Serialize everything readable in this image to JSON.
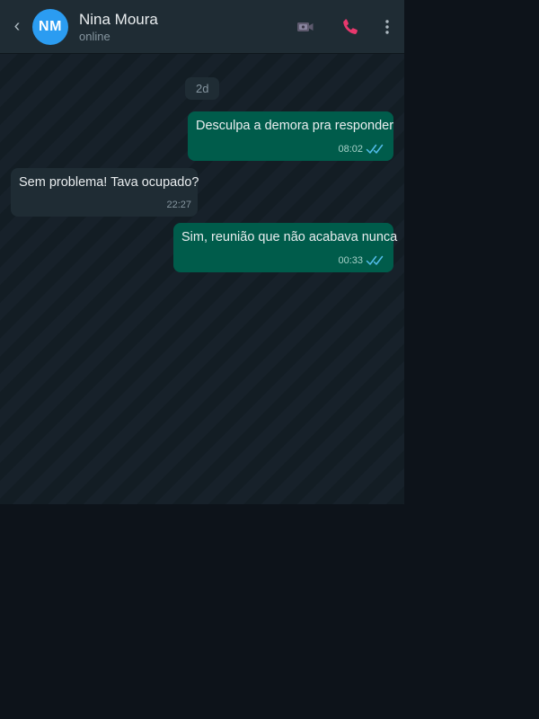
{
  "header": {
    "back_label": "‹",
    "avatar_initials": "NM",
    "contact_name": "Nina Moura",
    "contact_status": "online",
    "icons": [
      "video-call-icon",
      "voice-call-icon",
      "more-options-icon"
    ]
  },
  "chat": {
    "date_divider": "2d",
    "messages": [
      {
        "direction": "outgoing",
        "text": "Desculpa a demora pra responder",
        "time": "08:02",
        "status": "read"
      },
      {
        "direction": "incoming",
        "text": "Sem problema! Tava ocupado?",
        "time": "22:27"
      },
      {
        "direction": "outgoing",
        "text": "Sim, reunião que não acabava nunca",
        "time": "00:33",
        "status": "read"
      }
    ]
  },
  "colors": {
    "header_bg": "#1f2c34",
    "avatar_bg": "#2b9cf1",
    "outgoing_bubble": "#005c4b",
    "incoming_bubble": "#1f2c34",
    "read_ticks": "#53bdeb",
    "call_icon": "#e8386d",
    "page_bg": "#0d131a"
  }
}
